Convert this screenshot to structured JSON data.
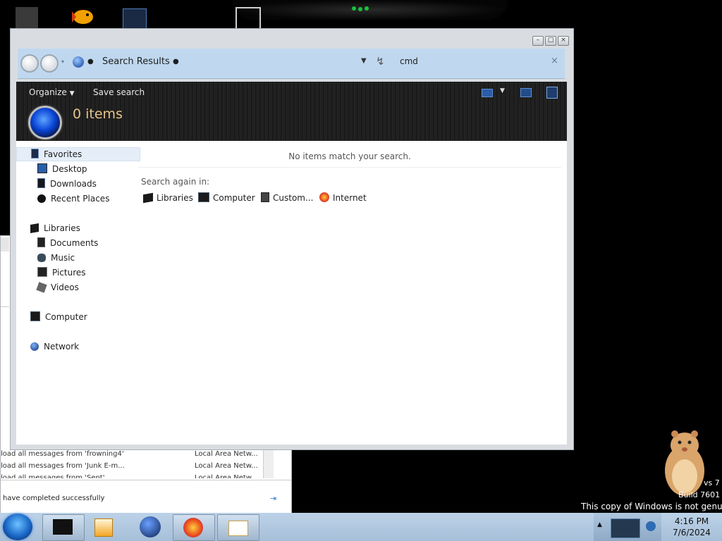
{
  "explorer": {
    "location": "Search Results",
    "search_value": "cmd",
    "toolbar": {
      "organize": "Organize",
      "save_search": "Save search"
    },
    "item_count": "0 items",
    "no_items_message": "No items match your search.",
    "search_again_label": "Search again in:",
    "search_again_locations": [
      "Libraries",
      "Computer",
      "Custom...",
      "Internet"
    ],
    "nav": {
      "favorites": "Favorites",
      "desktop": "Desktop",
      "downloads": "Downloads",
      "recent_places": "Recent Places",
      "libraries": "Libraries",
      "documents": "Documents",
      "music": "Music",
      "pictures": "Pictures",
      "videos": "Videos",
      "computer": "Computer",
      "network": "Network"
    }
  },
  "background_window": {
    "rows": [
      {
        "col1": "load all messages from 'frowning4'",
        "col2": "Local Area Netw..."
      },
      {
        "col1": "load all messages from 'Junk E-m...",
        "col2": "Local Area Netw..."
      },
      {
        "col1": "load all messages from 'Sent'",
        "col2": "Local Area Netw..."
      }
    ],
    "status": "have completed successfully"
  },
  "desktop": {
    "watermark_line1": "vs 7",
    "watermark_line2": "Build 7601",
    "watermark_line3": "This copy of Windows is not genuine"
  },
  "taskbar": {
    "time": "4:16 PM",
    "date": "7/6/2024"
  }
}
